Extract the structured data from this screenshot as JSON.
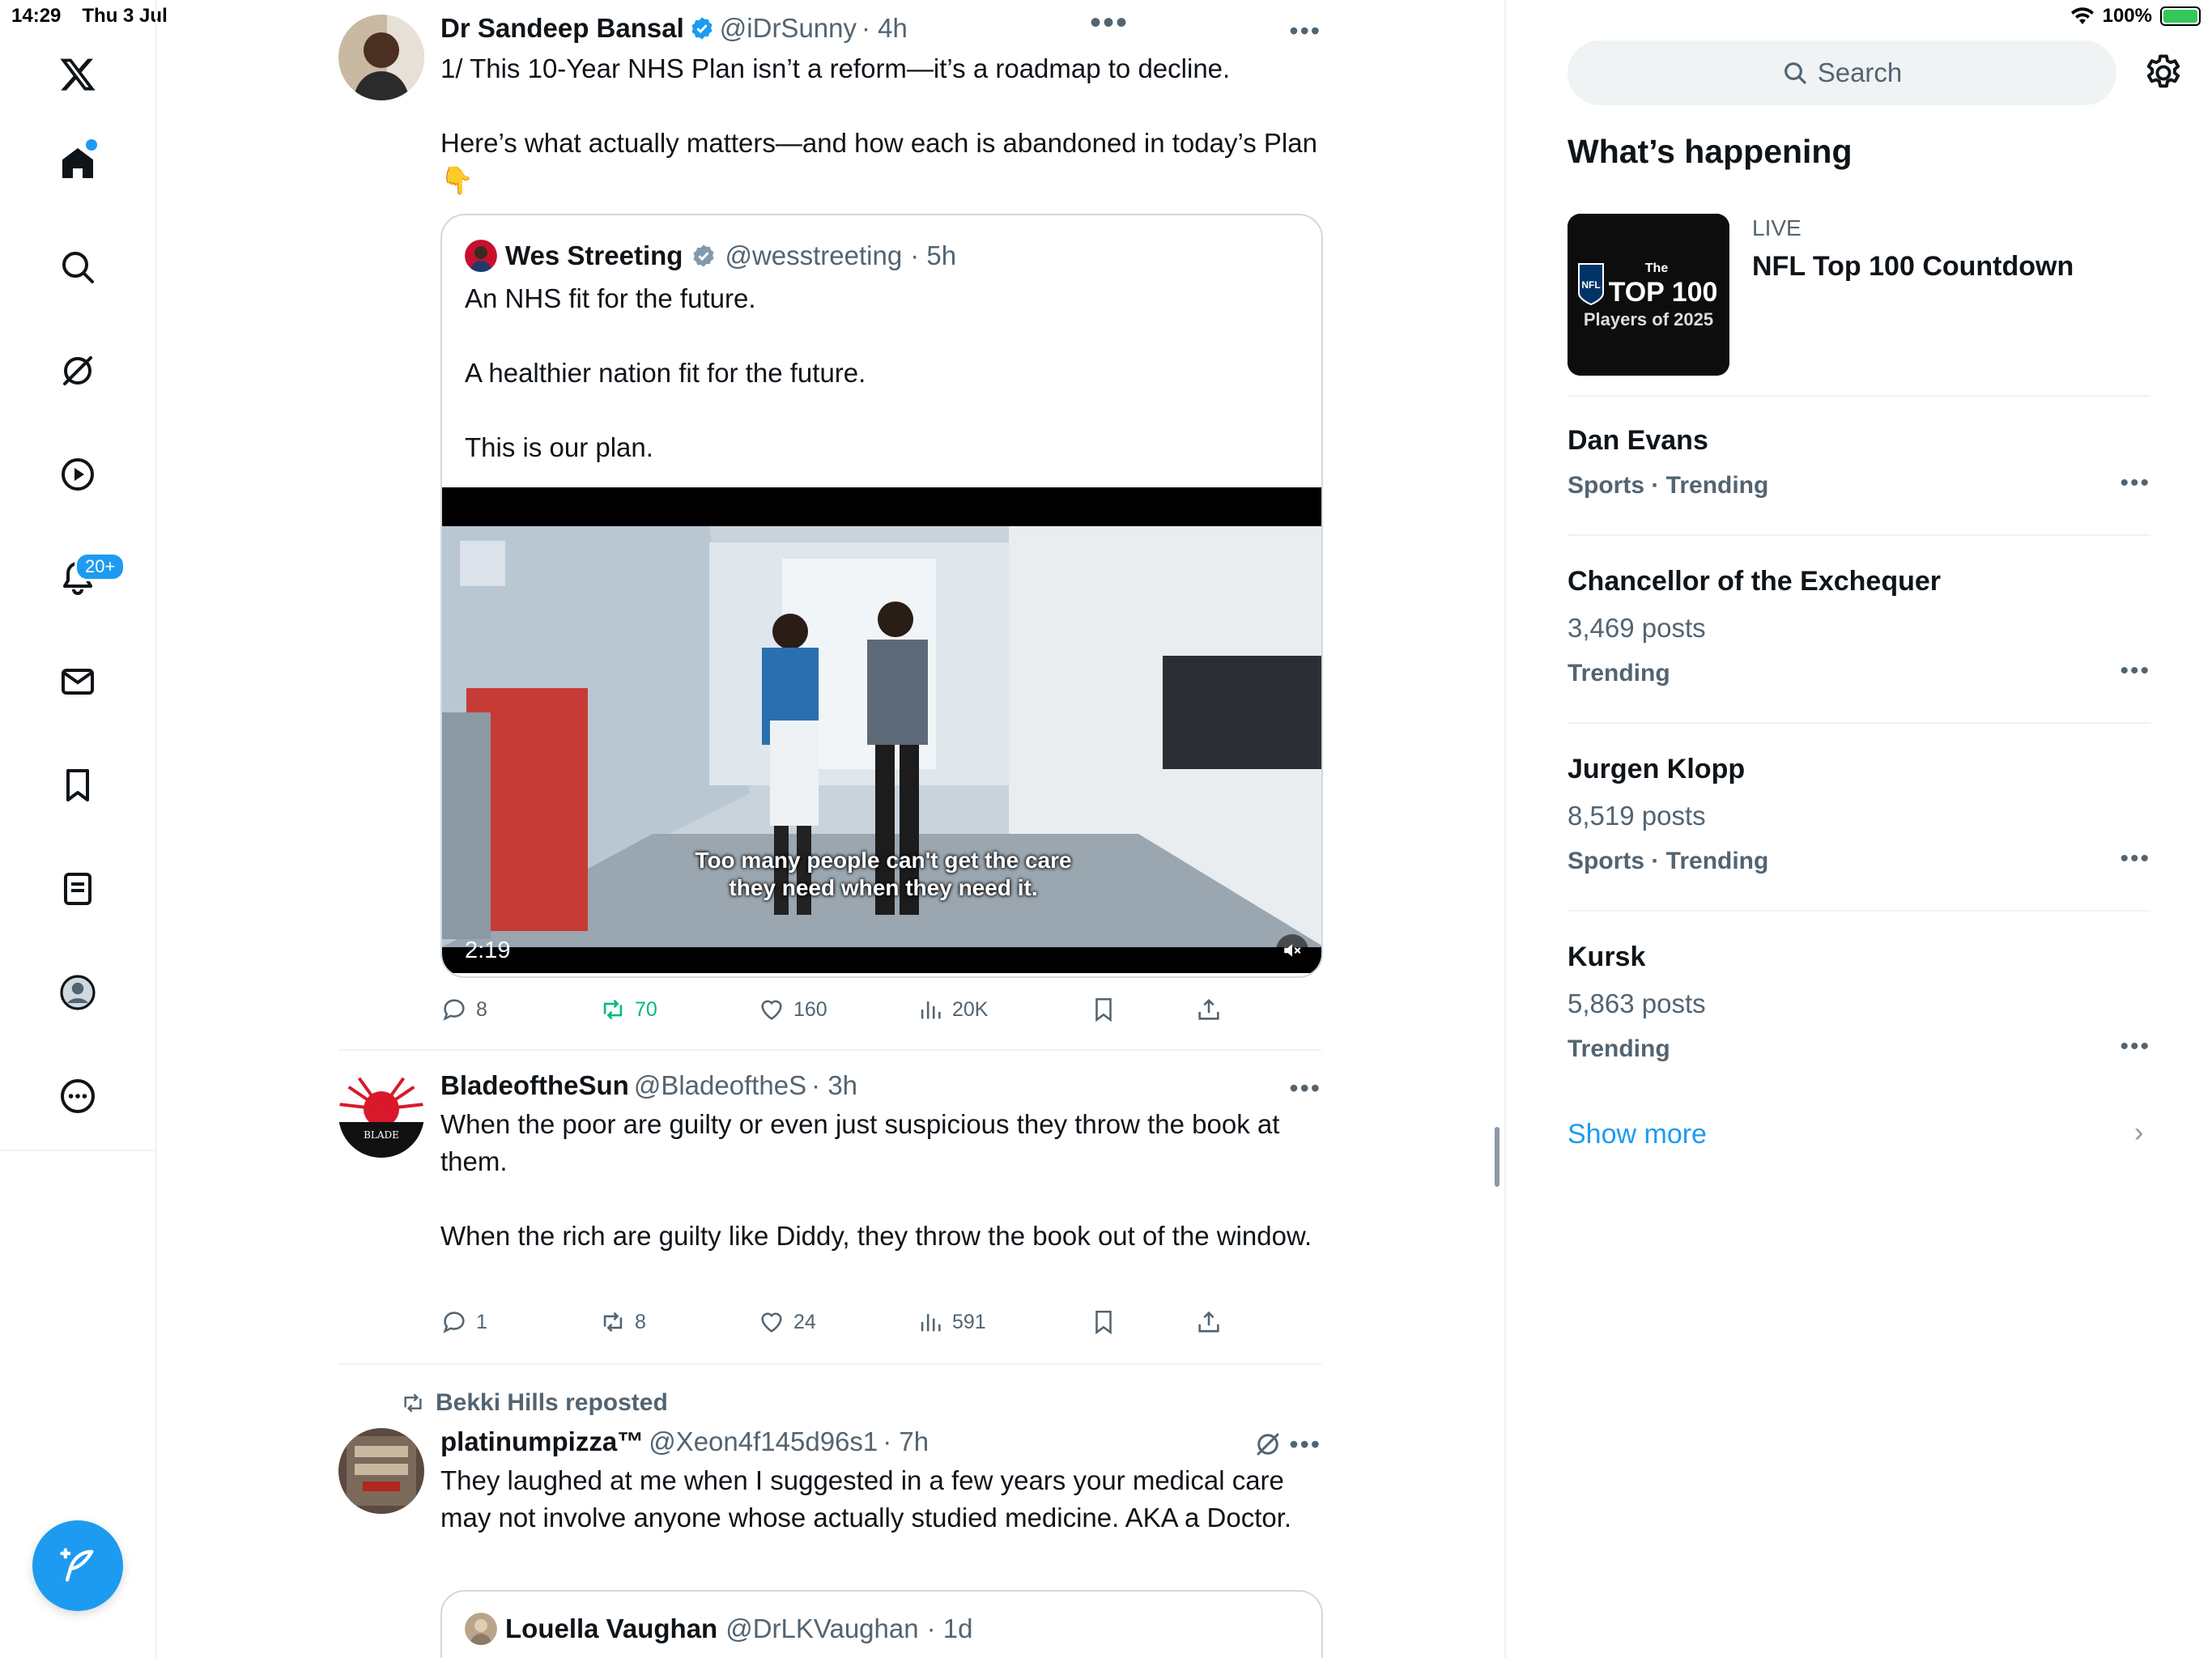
{
  "status_bar": {
    "time": "14:29",
    "date": "Thu 3 Jul",
    "battery": "100%"
  },
  "nav": {
    "notifications_badge": "20+",
    "accent": "#1d9bf0"
  },
  "feed": {
    "posts": [
      {
        "name": "Dr Sandeep Bansal",
        "handle": "@iDrSunny",
        "time": "· 4h",
        "text": "1/ This 10-Year NHS Plan isn’t a reform—it’s a roadmap to decline.\n\nHere’s what actually matters—and how each is abandoned in today’s Plan 👇",
        "quote": {
          "name": "Wes Streeting",
          "handle": "@wesstreeting",
          "time": "· 5h",
          "text": "An NHS fit for the future.\n\nA healthier nation fit for the future.\n\nThis is our plan.",
          "video_caption": "Too many people can't get the care\nthey need when they need it.",
          "video_time": "2:19"
        },
        "stats": {
          "replies": "8",
          "reposts": "70",
          "likes": "160",
          "views": "20K"
        }
      },
      {
        "name": "BladeoftheSun",
        "handle": "@BladeoftheS",
        "time": "· 3h",
        "text": "When the poor are guilty or even just suspicious they throw the book at them.\n\nWhen the rich are guilty like Diddy, they throw the book out of the window.",
        "stats": {
          "replies": "1",
          "reposts": "8",
          "likes": "24",
          "views": "591"
        }
      },
      {
        "repost_label": "Bekki Hills reposted",
        "name": "platinumpizza™",
        "handle": "@Xeon4f145d96s1",
        "time": "· 7h",
        "text": "They laughed at me when I suggested in a few years your medical care may not involve anyone whose actually studied medicine. AKA a Doctor.",
        "quote": {
          "name": "Louella Vaughan",
          "handle": "@DrLKVaughan",
          "time": "· 1d"
        }
      }
    ]
  },
  "right": {
    "search_placeholder": "Search",
    "title": "What’s happening",
    "live": {
      "tag": "LIVE",
      "title": "NFL Top 100 Countdown",
      "thumb_lines": [
        "The",
        "TOP 100",
        "Players of 2025"
      ]
    },
    "trends": [
      {
        "title": "Dan Evans",
        "posts": "",
        "meta": "Sports · Trending"
      },
      {
        "title": "Chancellor of the Exchequer",
        "posts": "3,469 posts",
        "meta": "Trending"
      },
      {
        "title": "Jurgen Klopp",
        "posts": "8,519 posts",
        "meta": "Sports · Trending"
      },
      {
        "title": "Kursk",
        "posts": "5,863 posts",
        "meta": "Trending"
      }
    ],
    "show_more": "Show more"
  }
}
